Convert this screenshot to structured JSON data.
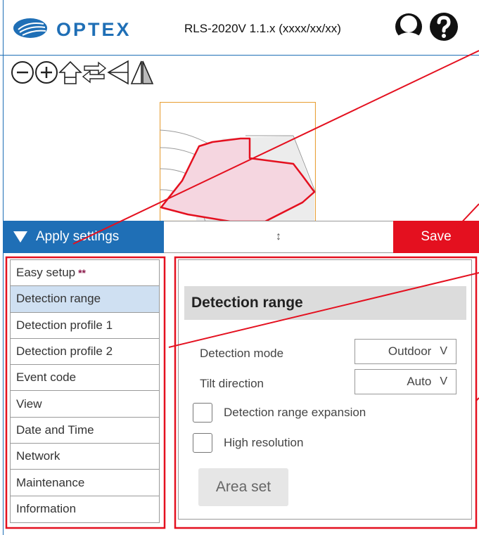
{
  "header": {
    "brand": "OPTEX",
    "firmware": "RLS-2020V 1.1.x (xxxx/xx/xx)",
    "icons": [
      "user-icon",
      "help-icon"
    ]
  },
  "toolbar": {
    "icons": [
      "zoom-out-icon",
      "zoom-in-icon",
      "home-icon",
      "swap-arrows-icon",
      "rotate-icon",
      "flip-icon"
    ]
  },
  "action_bar": {
    "apply_label": "Apply settings",
    "resize_glyph": "↕",
    "save_label": "Save"
  },
  "sidebar": {
    "items": [
      {
        "label": "Easy setup",
        "marker": "**"
      },
      {
        "label": "Detection range"
      },
      {
        "label": "Detection profile 1"
      },
      {
        "label": "Detection profile 2"
      },
      {
        "label": "Event code"
      },
      {
        "label": "View"
      },
      {
        "label": "Date and Time"
      },
      {
        "label": "Network"
      },
      {
        "label": "Maintenance"
      },
      {
        "label": "Information"
      }
    ],
    "active_index": 1
  },
  "content": {
    "title": "Detection range",
    "detection_mode": {
      "label": "Detection mode",
      "value": "Outdoor",
      "arrow": "V"
    },
    "tilt_direction": {
      "label": "Tilt direction",
      "value": "Auto",
      "arrow": "V"
    },
    "range_expansion": {
      "label": "Detection range expansion",
      "checked": false
    },
    "high_resolution": {
      "label": "High resolution",
      "checked": false
    },
    "area_set_label": "Area set"
  },
  "colors": {
    "brand_blue": "#1f6fb6",
    "save_red": "#e4101f",
    "annotation_red": "#e4101f",
    "area_fill": "#f5d6e0",
    "map_border": "#e8a13a"
  }
}
